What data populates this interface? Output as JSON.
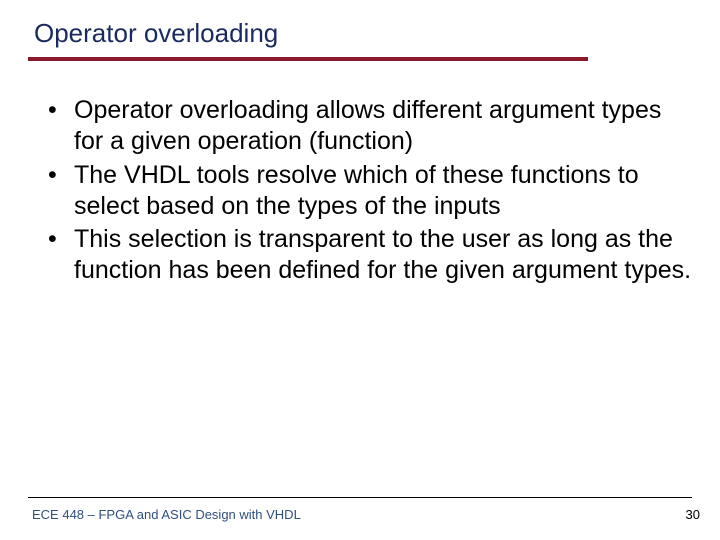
{
  "title": "Operator overloading",
  "bullets": [
    "Operator overloading allows different argument types for a given operation (function)",
    "The VHDL tools resolve which of these functions to select based on the types of the inputs",
    "This selection is transparent to the user as long as the function has been defined for the given argument types."
  ],
  "footer": "ECE 448 – FPGA and ASIC Design with VHDL",
  "page": "30"
}
